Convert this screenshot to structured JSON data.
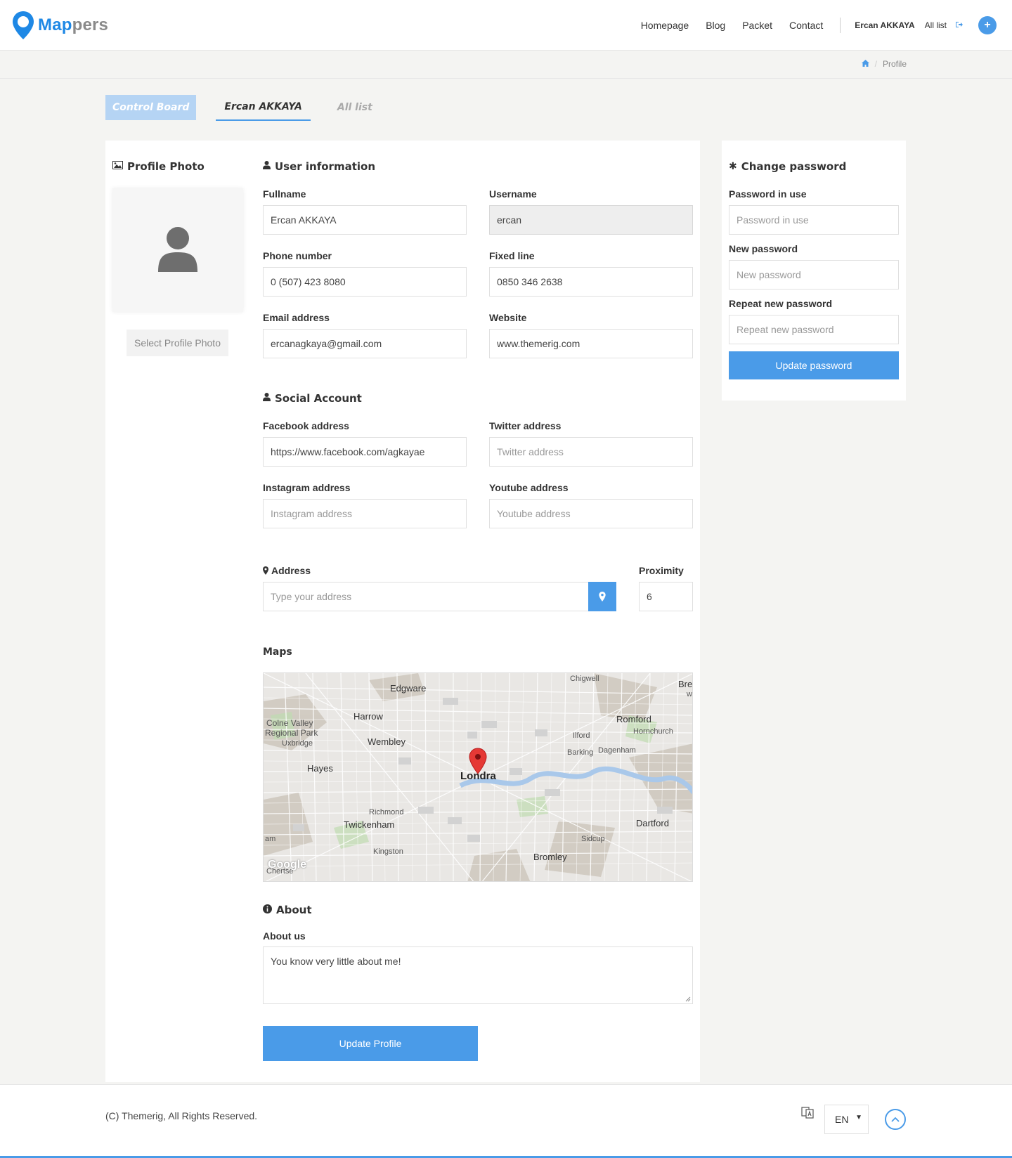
{
  "brand": {
    "name_part1": "Map",
    "name_part2": "pers",
    "primary_color": "#4a9be8",
    "logo_color": "#1e88e5"
  },
  "nav": {
    "links": [
      "Homepage",
      "Blog",
      "Packet",
      "Contact"
    ],
    "user_name": "Ercan AKKAYA",
    "all_list": "All list",
    "logout_icon": "sign-out-icon",
    "add_icon": "plus-icon"
  },
  "breadcrumb": {
    "home_icon": "home-icon",
    "current": "Profile"
  },
  "tabs": {
    "control_board": "Control Board",
    "user": "Ercan AKKAYA",
    "all_list": "All list"
  },
  "profile_photo": {
    "title": "Profile Photo",
    "select_button": "Select Profile Photo"
  },
  "user_info": {
    "title": "User information",
    "fullname": {
      "label": "Fullname",
      "value": "Ercan AKKAYA"
    },
    "username": {
      "label": "Username",
      "value": "ercan"
    },
    "phone": {
      "label": "Phone number",
      "value": "0 (507) 423 8080"
    },
    "fixed_line": {
      "label": "Fixed line",
      "value": "0850 346 2638"
    },
    "email": {
      "label": "Email address",
      "value": "ercanagkaya@gmail.com"
    },
    "website": {
      "label": "Website",
      "value": "www.themerig.com"
    }
  },
  "social": {
    "title": "Social Account",
    "facebook": {
      "label": "Facebook address",
      "value": "https://www.facebook.com/agkayae"
    },
    "twitter": {
      "label": "Twitter address",
      "placeholder": "Twitter address"
    },
    "instagram": {
      "label": "Instagram address",
      "placeholder": "Instagram address"
    },
    "youtube": {
      "label": "Youtube address",
      "placeholder": "Youtube address"
    }
  },
  "address": {
    "label": "Address",
    "placeholder": "Type your address",
    "proximity_label": "Proximity",
    "proximity_value": "6"
  },
  "maps": {
    "title": "Maps",
    "places": [
      "Chigwell",
      "Edgware",
      "Harrow",
      "Colne Valley",
      "Regional Park",
      "Uxbridge",
      "Wembley",
      "Romford",
      "Hornchurch",
      "Ilford",
      "Barking",
      "Dagenham",
      "Hayes",
      "Londra",
      "Richmond",
      "Twickenham",
      "Dartford",
      "Sidcup",
      "Kingston",
      "Bromley",
      "Bre",
      "w",
      "am",
      "Chertse"
    ],
    "attribution": "Google"
  },
  "about": {
    "title": "About",
    "label": "About us",
    "value": "You know very little about me!"
  },
  "update_profile": "Update Profile",
  "password": {
    "title": "Change password",
    "in_use": {
      "label": "Password in use",
      "placeholder": "Password in use"
    },
    "new": {
      "label": "New password",
      "placeholder": "New password"
    },
    "repeat": {
      "label": "Repeat new password",
      "placeholder": "Repeat new password"
    },
    "button": "Update password"
  },
  "footer": {
    "copyright": "(C) Themerig, All Rights Reserved.",
    "language": "EN"
  }
}
